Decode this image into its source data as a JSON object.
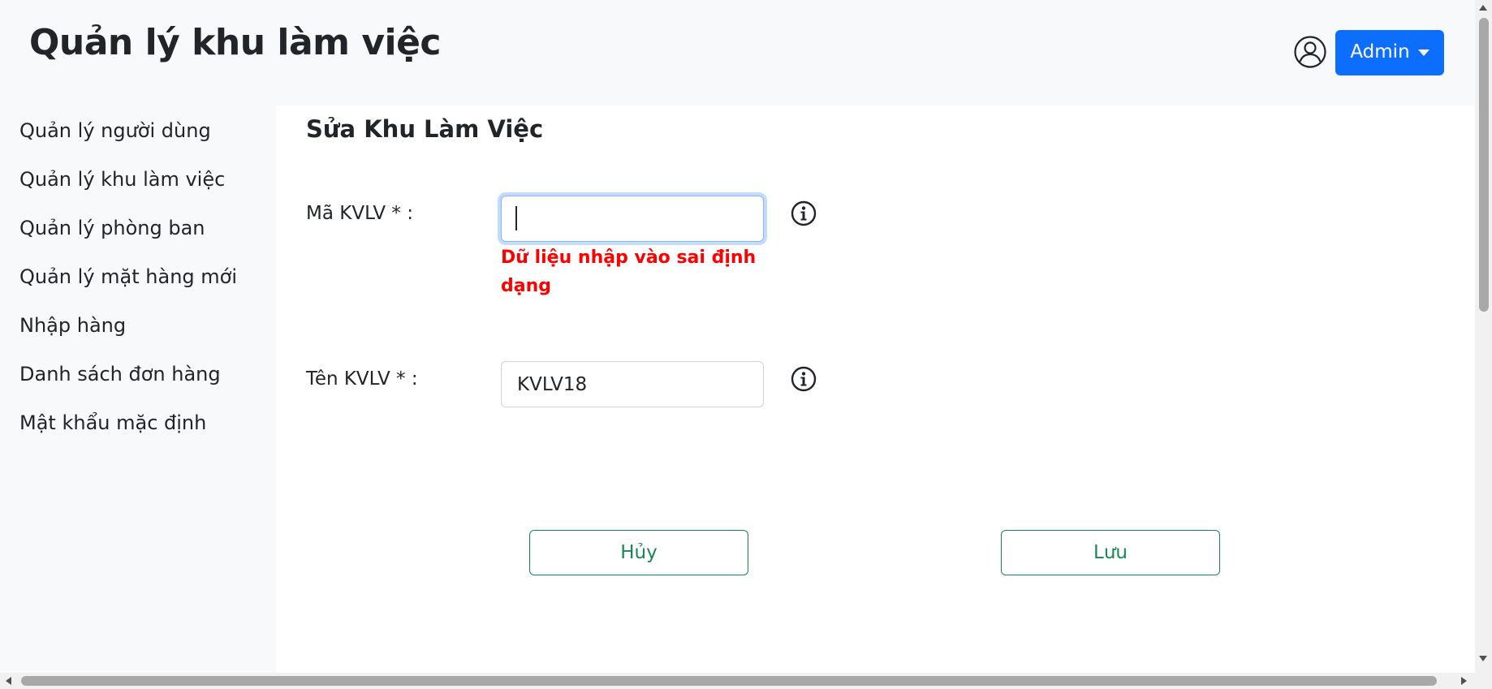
{
  "header": {
    "title": "Quản lý khu làm việc",
    "user_menu_label": "Admin"
  },
  "sidebar": {
    "items": [
      {
        "label": "Quản lý người dùng"
      },
      {
        "label": "Quản lý khu làm việc"
      },
      {
        "label": "Quản lý phòng ban"
      },
      {
        "label": "Quản lý mặt hàng mới"
      },
      {
        "label": "Nhập hàng"
      },
      {
        "label": "Danh sách đơn hàng"
      },
      {
        "label": "Mật khẩu mặc định"
      }
    ]
  },
  "form": {
    "title": "Sửa Khu Làm Việc",
    "code_label": "Mã KVLV * :",
    "code_value": "",
    "code_error": "Dữ liệu nhập vào sai định dạng",
    "name_label": "Tên KVLV * :",
    "name_value": "KVLV18",
    "cancel_label": "Hủy",
    "save_label": "Lưu"
  },
  "icons": {
    "user": "user-circle-icon",
    "info": "info-circle-icon"
  },
  "colors": {
    "primary": "#0d6efd",
    "success": "#198754",
    "error": "#ff0000",
    "sidebar_bg": "#f8f9fa",
    "panel_bg": "#ffffff"
  }
}
